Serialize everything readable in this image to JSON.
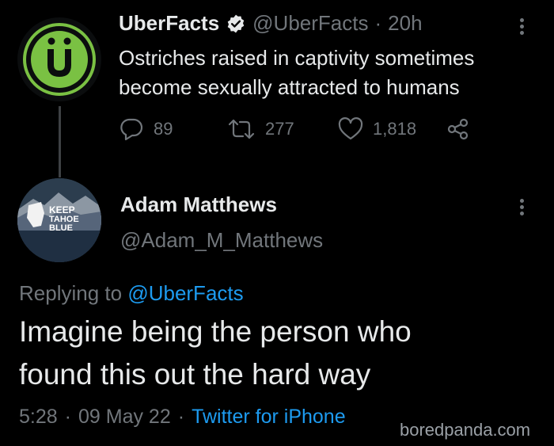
{
  "tweet": {
    "author_name": "UberFacts",
    "author_handle": "@UberFacts",
    "separator": "·",
    "time": "20h",
    "avatar_letter": "Ü",
    "text_line1": "Ostriches raised in captivity sometimes",
    "text_line2": "become sexually attracted to humans",
    "replies": "89",
    "retweets": "277",
    "likes": "1,818"
  },
  "reply": {
    "author_name": "Adam Matthews",
    "author_handle": "@Adam_M_Matthews",
    "avatar_text_1": "KEEP",
    "avatar_text_2": "TAHOE",
    "avatar_text_3": "BLUE",
    "replying_prefix": "Replying to",
    "replying_handle": "@UberFacts",
    "text_line1": "Imagine being the person who",
    "text_line2": "found this out the hard way",
    "time": "5:28",
    "sep1": "·",
    "date": "09 May 22",
    "sep2": "·",
    "source": "Twitter for iPhone"
  },
  "watermark": "boredpanda.com",
  "colors": {
    "background": "#000000",
    "text": "#e7e9ea",
    "muted": "#71767b",
    "link": "#1d9bf0",
    "uberfacts_green": "#7ac143"
  },
  "icons": [
    "verified-icon",
    "more-icon",
    "reply-icon",
    "retweet-icon",
    "like-icon",
    "share-icon"
  ]
}
